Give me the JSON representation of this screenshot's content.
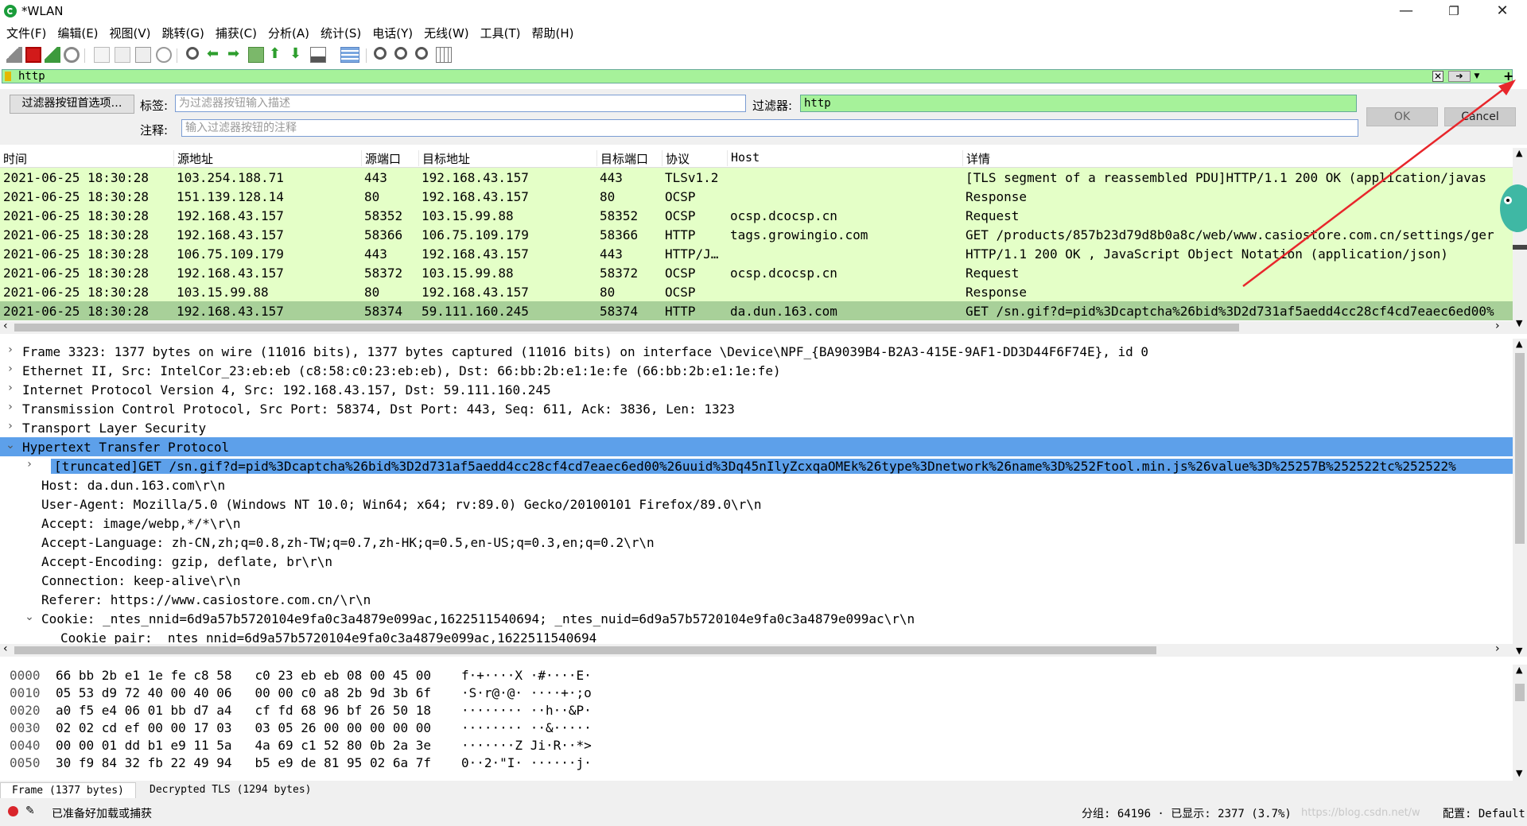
{
  "window": {
    "title": "*WLAN",
    "min": "—",
    "max": "❐",
    "close": "✕"
  },
  "menu": [
    "文件(F)",
    "编辑(E)",
    "视图(V)",
    "跳转(G)",
    "捕获(C)",
    "分析(A)",
    "统计(S)",
    "电话(Y)",
    "无线(W)",
    "工具(T)",
    "帮助(H)"
  ],
  "toolbar": {
    "icons": [
      "shark-fin-start-icon",
      "stop-capture-icon",
      "restart-capture-icon",
      "capture-options-icon",
      "open-file-icon",
      "save-file-icon",
      "close-file-icon",
      "reload-file-icon",
      "find-packet-icon",
      "go-back-icon",
      "go-forward-icon",
      "go-to-packet-icon",
      "go-first-packet-icon",
      "go-last-packet-icon",
      "auto-scroll-icon",
      "colorize-icon",
      "zoom-in-icon",
      "zoom-out-icon",
      "normal-size-icon",
      "resize-columns-icon"
    ]
  },
  "filter": {
    "value": "http",
    "plus": "+"
  },
  "button_editor": {
    "prefs_button": "过滤器按钮首选项…",
    "label_label": "标签:",
    "label_placeholder": "为过滤器按钮输入描述",
    "filter_label": "过滤器:",
    "filter_value": "http",
    "comment_label": "注释:",
    "comment_placeholder": "输入过滤器按钮的注释",
    "ok": "OK",
    "cancel": "Cancel"
  },
  "packet_list": {
    "columns": [
      "时间",
      "源地址",
      "源端口",
      "目标地址",
      "目标端口",
      "协议",
      "Host",
      "详情"
    ],
    "rows": [
      [
        "2021-06-25 18:30:28",
        "103.254.188.71",
        "443",
        "192.168.43.157",
        "443",
        "TLSv1.2",
        "",
        "[TLS segment of a reassembled PDU]HTTP/1.1 200 OK  (application/javas"
      ],
      [
        "2021-06-25 18:30:28",
        "151.139.128.14",
        "80",
        "192.168.43.157",
        "80",
        "OCSP",
        "",
        "Response"
      ],
      [
        "2021-06-25 18:30:28",
        "192.168.43.157",
        "58352",
        "103.15.99.88",
        "58352",
        "OCSP",
        "ocsp.dcocsp.cn",
        "Request"
      ],
      [
        "2021-06-25 18:30:28",
        "192.168.43.157",
        "58366",
        "106.75.109.179",
        "58366",
        "HTTP",
        "tags.growingio.com",
        "GET /products/857b23d79d8b0a8c/web/www.casiostore.com.cn/settings/ger"
      ],
      [
        "2021-06-25 18:30:28",
        "106.75.109.179",
        "443",
        "192.168.43.157",
        "443",
        "HTTP/J…",
        "",
        "HTTP/1.1 200 OK , JavaScript Object Notation (application/json)"
      ],
      [
        "2021-06-25 18:30:28",
        "192.168.43.157",
        "58372",
        "103.15.99.88",
        "58372",
        "OCSP",
        "ocsp.dcocsp.cn",
        "Request"
      ],
      [
        "2021-06-25 18:30:28",
        "103.15.99.88",
        "80",
        "192.168.43.157",
        "80",
        "OCSP",
        "",
        "Response"
      ],
      [
        "2021-06-25 18:30:28",
        "192.168.43.157",
        "58374",
        "59.111.160.245",
        "58374",
        "HTTP",
        "da.dun.163.com",
        "GET /sn.gif?d=pid%3Dcaptcha%26bid%3D2d731af5aedd4cc28cf4cd7eaec6ed00%"
      ]
    ]
  },
  "details": [
    {
      "arrow": "›",
      "indent": 0,
      "text": "Frame 3323: 1377 bytes on wire (11016 bits), 1377 bytes captured (11016 bits) on interface \\Device\\NPF_{BA9039B4-B2A3-415E-9AF1-DD3D44F6F74E}, id 0"
    },
    {
      "arrow": "›",
      "indent": 0,
      "text": "Ethernet II, Src: IntelCor_23:eb:eb (c8:58:c0:23:eb:eb), Dst: 66:bb:2b:e1:1e:fe (66:bb:2b:e1:1e:fe)"
    },
    {
      "arrow": "›",
      "indent": 0,
      "text": "Internet Protocol Version 4, Src: 192.168.43.157, Dst: 59.111.160.245"
    },
    {
      "arrow": "›",
      "indent": 0,
      "text": "Transmission Control Protocol, Src Port: 58374, Dst Port: 443, Seq: 611, Ack: 3836, Len: 1323"
    },
    {
      "arrow": "›",
      "indent": 0,
      "text": "Transport Layer Security"
    },
    {
      "arrow": "⌄",
      "indent": 0,
      "text": "Hypertext Transfer Protocol"
    },
    {
      "arrow": "›",
      "indent": 1,
      "text": "[truncated]GET /sn.gif?d=pid%3Dcaptcha%26bid%3D2d731af5aedd4cc28cf4cd7eaec6ed00%26uuid%3Dq45nIlyZcxqaOMEk%26type%3Dnetwork%26name%3D%252Ftool.min.js%26value%3D%25257B%252522tc%252522%"
    },
    {
      "arrow": "",
      "indent": 1,
      "text": "Host: da.dun.163.com\\r\\n"
    },
    {
      "arrow": "",
      "indent": 1,
      "text": "User-Agent: Mozilla/5.0 (Windows NT 10.0; Win64; x64; rv:89.0) Gecko/20100101 Firefox/89.0\\r\\n"
    },
    {
      "arrow": "",
      "indent": 1,
      "text": "Accept: image/webp,*/*\\r\\n"
    },
    {
      "arrow": "",
      "indent": 1,
      "text": "Accept-Language: zh-CN,zh;q=0.8,zh-TW;q=0.7,zh-HK;q=0.5,en-US;q=0.3,en;q=0.2\\r\\n"
    },
    {
      "arrow": "",
      "indent": 1,
      "text": "Accept-Encoding: gzip, deflate, br\\r\\n"
    },
    {
      "arrow": "",
      "indent": 1,
      "text": "Connection: keep-alive\\r\\n"
    },
    {
      "arrow": "",
      "indent": 1,
      "text": "Referer: https://www.casiostore.com.cn/\\r\\n"
    },
    {
      "arrow": "⌄",
      "indent": 1,
      "text": "Cookie: _ntes_nnid=6d9a57b5720104e9fa0c3a4879e099ac,1622511540694; _ntes_nuid=6d9a57b5720104e9fa0c3a4879e099ac\\r\\n"
    },
    {
      "arrow": "",
      "indent": 2,
      "text": "Cookie pair: _ntes_nnid=6d9a57b5720104e9fa0c3a4879e099ac,1622511540694"
    }
  ],
  "hex": [
    {
      "off": "0000",
      "bytes": "66 bb 2b e1 1e fe c8 58   c0 23 eb eb 08 00 45 00",
      "ascii": "f·+····X ·#····E·"
    },
    {
      "off": "0010",
      "bytes": "05 53 d9 72 40 00 40 06   00 00 c0 a8 2b 9d 3b 6f",
      "ascii": "·S·r@·@· ····+·;o"
    },
    {
      "off": "0020",
      "bytes": "a0 f5 e4 06 01 bb d7 a4   cf fd 68 96 bf 26 50 18",
      "ascii": "········ ··h··&P·"
    },
    {
      "off": "0030",
      "bytes": "02 02 cd ef 00 00 17 03   03 05 26 00 00 00 00 00",
      "ascii": "········ ··&·····"
    },
    {
      "off": "0040",
      "bytes": "00 00 01 dd b1 e9 11 5a   4a 69 c1 52 80 0b 2a 3e",
      "ascii": "·······Z Ji·R··*>"
    },
    {
      "off": "0050",
      "bytes": "30 f9 84 32 fb 22 49 94   b5 e9 de 81 95 02 6a 7f",
      "ascii": "0··2·\"I· ······j·"
    }
  ],
  "byte_tabs": [
    "Frame (1377 bytes)",
    "Decrypted TLS (1294 bytes)"
  ],
  "status": {
    "message": "已准备好加载或捕获",
    "stats": "分组: 64196 · 已显示: 2377 (3.7%)",
    "profile": "配置: Default",
    "watermark": "https://blog.csdn.net/w"
  },
  "colors": {
    "filter_bg": "#a6f29a",
    "row_bg": "#e4ffc7",
    "row_selected": "#a8d099",
    "detail_highlight": "#5da0ea",
    "annotation": "#e8262b"
  }
}
